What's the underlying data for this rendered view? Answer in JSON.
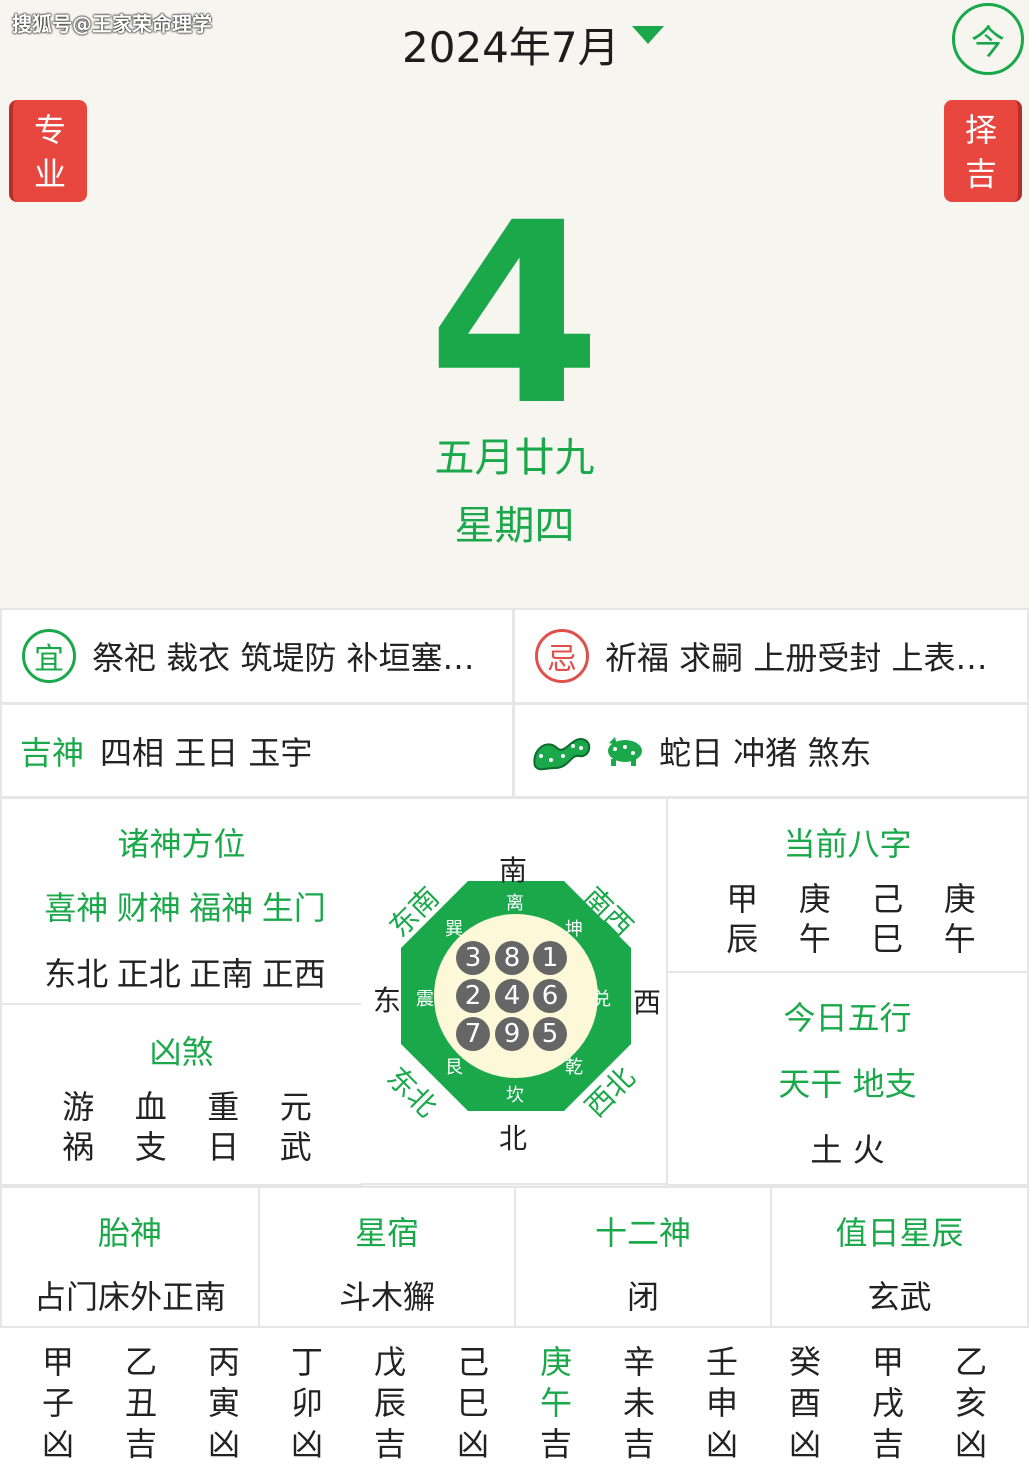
{
  "watermark": "搜狐号@王家荣命理学",
  "header": {
    "month_title": "2024年7月",
    "today_button": "今",
    "left_tab": [
      "专",
      "业"
    ],
    "right_tab": [
      "择",
      "吉"
    ],
    "day": "4",
    "lunar_date": "五月廿九",
    "weekday": "星期四"
  },
  "yi": {
    "seal": "宜",
    "text": "祭祀 裁衣 筑堤防 补垣塞…"
  },
  "ji": {
    "seal": "忌",
    "text": "祈福 求嗣 上册受封 上表…"
  },
  "jishen": {
    "label": "吉神",
    "text": "四相 王日 玉宇"
  },
  "chong": {
    "text": "蛇日 冲猪 煞东"
  },
  "zhushen": {
    "title": "诸神方位",
    "gods": [
      "喜神",
      "财神",
      "福神",
      "生门"
    ],
    "directions": [
      "东北",
      "正北",
      "正南",
      "正西"
    ]
  },
  "xiongsha": {
    "title": "凶煞",
    "items": [
      [
        "游",
        "祸"
      ],
      [
        "血",
        "支"
      ],
      [
        "重",
        "日"
      ],
      [
        "元",
        "武"
      ]
    ]
  },
  "compass": {
    "south": "南",
    "north": "北",
    "east": "东",
    "west": "西",
    "southeast": "东南",
    "southwest": "南西",
    "northeast": "东北",
    "northwest": "西北",
    "trigram_li": "离",
    "trigram_kun": "坤",
    "trigram_dui": "兑",
    "trigram_qian": "乾",
    "trigram_kan": "坎",
    "trigram_gen": "艮",
    "trigram_zhen": "震",
    "trigram_xun": "巽",
    "numbers": [
      "3",
      "8",
      "1",
      "2",
      "4",
      "6",
      "7",
      "9",
      "5"
    ]
  },
  "bazi": {
    "title": "当前八字",
    "pillars": [
      [
        "甲",
        "辰"
      ],
      [
        "庚",
        "午"
      ],
      [
        "己",
        "巳"
      ],
      [
        "庚",
        "午"
      ]
    ]
  },
  "wuxing": {
    "title": "今日五行",
    "subtitle": "天干 地支",
    "value": "土 火"
  },
  "bottom": [
    {
      "title": "胎神",
      "value": "占门床外正南"
    },
    {
      "title": "星宿",
      "value": "斗木獬"
    },
    {
      "title": "十二神",
      "value": "闭"
    },
    {
      "title": "值日星辰",
      "value": "玄武"
    }
  ],
  "hours": [
    [
      "甲",
      "子",
      "凶"
    ],
    [
      "乙",
      "丑",
      "吉"
    ],
    [
      "丙",
      "寅",
      "凶"
    ],
    [
      "丁",
      "卯",
      "凶"
    ],
    [
      "戊",
      "辰",
      "吉"
    ],
    [
      "己",
      "巳",
      "凶"
    ],
    [
      "庚",
      "午",
      "吉"
    ],
    [
      "辛",
      "未",
      "吉"
    ],
    [
      "壬",
      "申",
      "凶"
    ],
    [
      "癸",
      "酉",
      "凶"
    ],
    [
      "甲",
      "戌",
      "吉"
    ],
    [
      "乙",
      "亥",
      "凶"
    ]
  ],
  "colors": {
    "accent": "#1aa84a",
    "danger": "#e8473f",
    "background": "#f6f5ef"
  },
  "icons": {
    "snake": "snake-icon",
    "pig": "pig-icon",
    "dropdown": "caret-down-icon"
  }
}
